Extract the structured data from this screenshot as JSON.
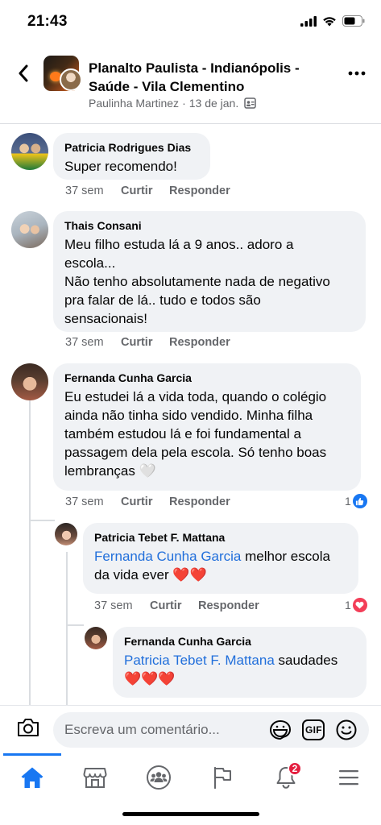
{
  "status": {
    "time": "21:43"
  },
  "header": {
    "title": "Planalto Paulista - Indianópolis - Saúde - Vila Clementino",
    "author": "Paulinha Martinez",
    "separator": "·",
    "date": "13 de jan."
  },
  "actions": {
    "like_label": "Curtir",
    "reply_label": "Responder"
  },
  "comments": [
    {
      "name": "Patricia Rodrigues Dias",
      "lines": [
        "Super recomendo!"
      ],
      "time": "37 sem"
    },
    {
      "name": "Thais Consani",
      "lines": [
        "Meu filho estuda lá a 9 anos.. adoro a",
        "escola...",
        "Não tenho absolutamente nada de negativo",
        "pra falar de lá..  tudo e todos são",
        "sensacionais!"
      ],
      "time": "37 sem"
    },
    {
      "name": "Fernanda Cunha Garcia",
      "lines": [
        "Eu estudei lá a vida toda, quando o colégio",
        "ainda não tinha sido vendido. Minha filha",
        "também estudou lá e foi fundamental a",
        "passagem dela pela escola. Só tenho boas",
        "lembranças 🤍"
      ],
      "time": "37 sem",
      "reaction_count": "1",
      "reaction": "like"
    }
  ],
  "replies": [
    {
      "name": "Patricia Tebet F. Mattana",
      "mention": "Fernanda Cunha Garcia",
      "text_after_mention": " melhor escola",
      "line2": "da vida ever ❤️❤️",
      "time": "37 sem",
      "reaction_count": "1",
      "reaction": "love"
    },
    {
      "name": "Fernanda Cunha Garcia",
      "mention": "Patricia Tebet F. Mattana",
      "text_after_mention": " saudades",
      "line2": "❤️❤️❤️"
    }
  ],
  "composer": {
    "placeholder": "Escreva um comentário...",
    "gif_label": "GIF"
  },
  "tabbar": {
    "notifications_badge": "2"
  },
  "colors": {
    "accent": "#1877f2",
    "mention": "#216fdb",
    "bubble": "#f0f2f5",
    "badge": "#e41e3f"
  }
}
